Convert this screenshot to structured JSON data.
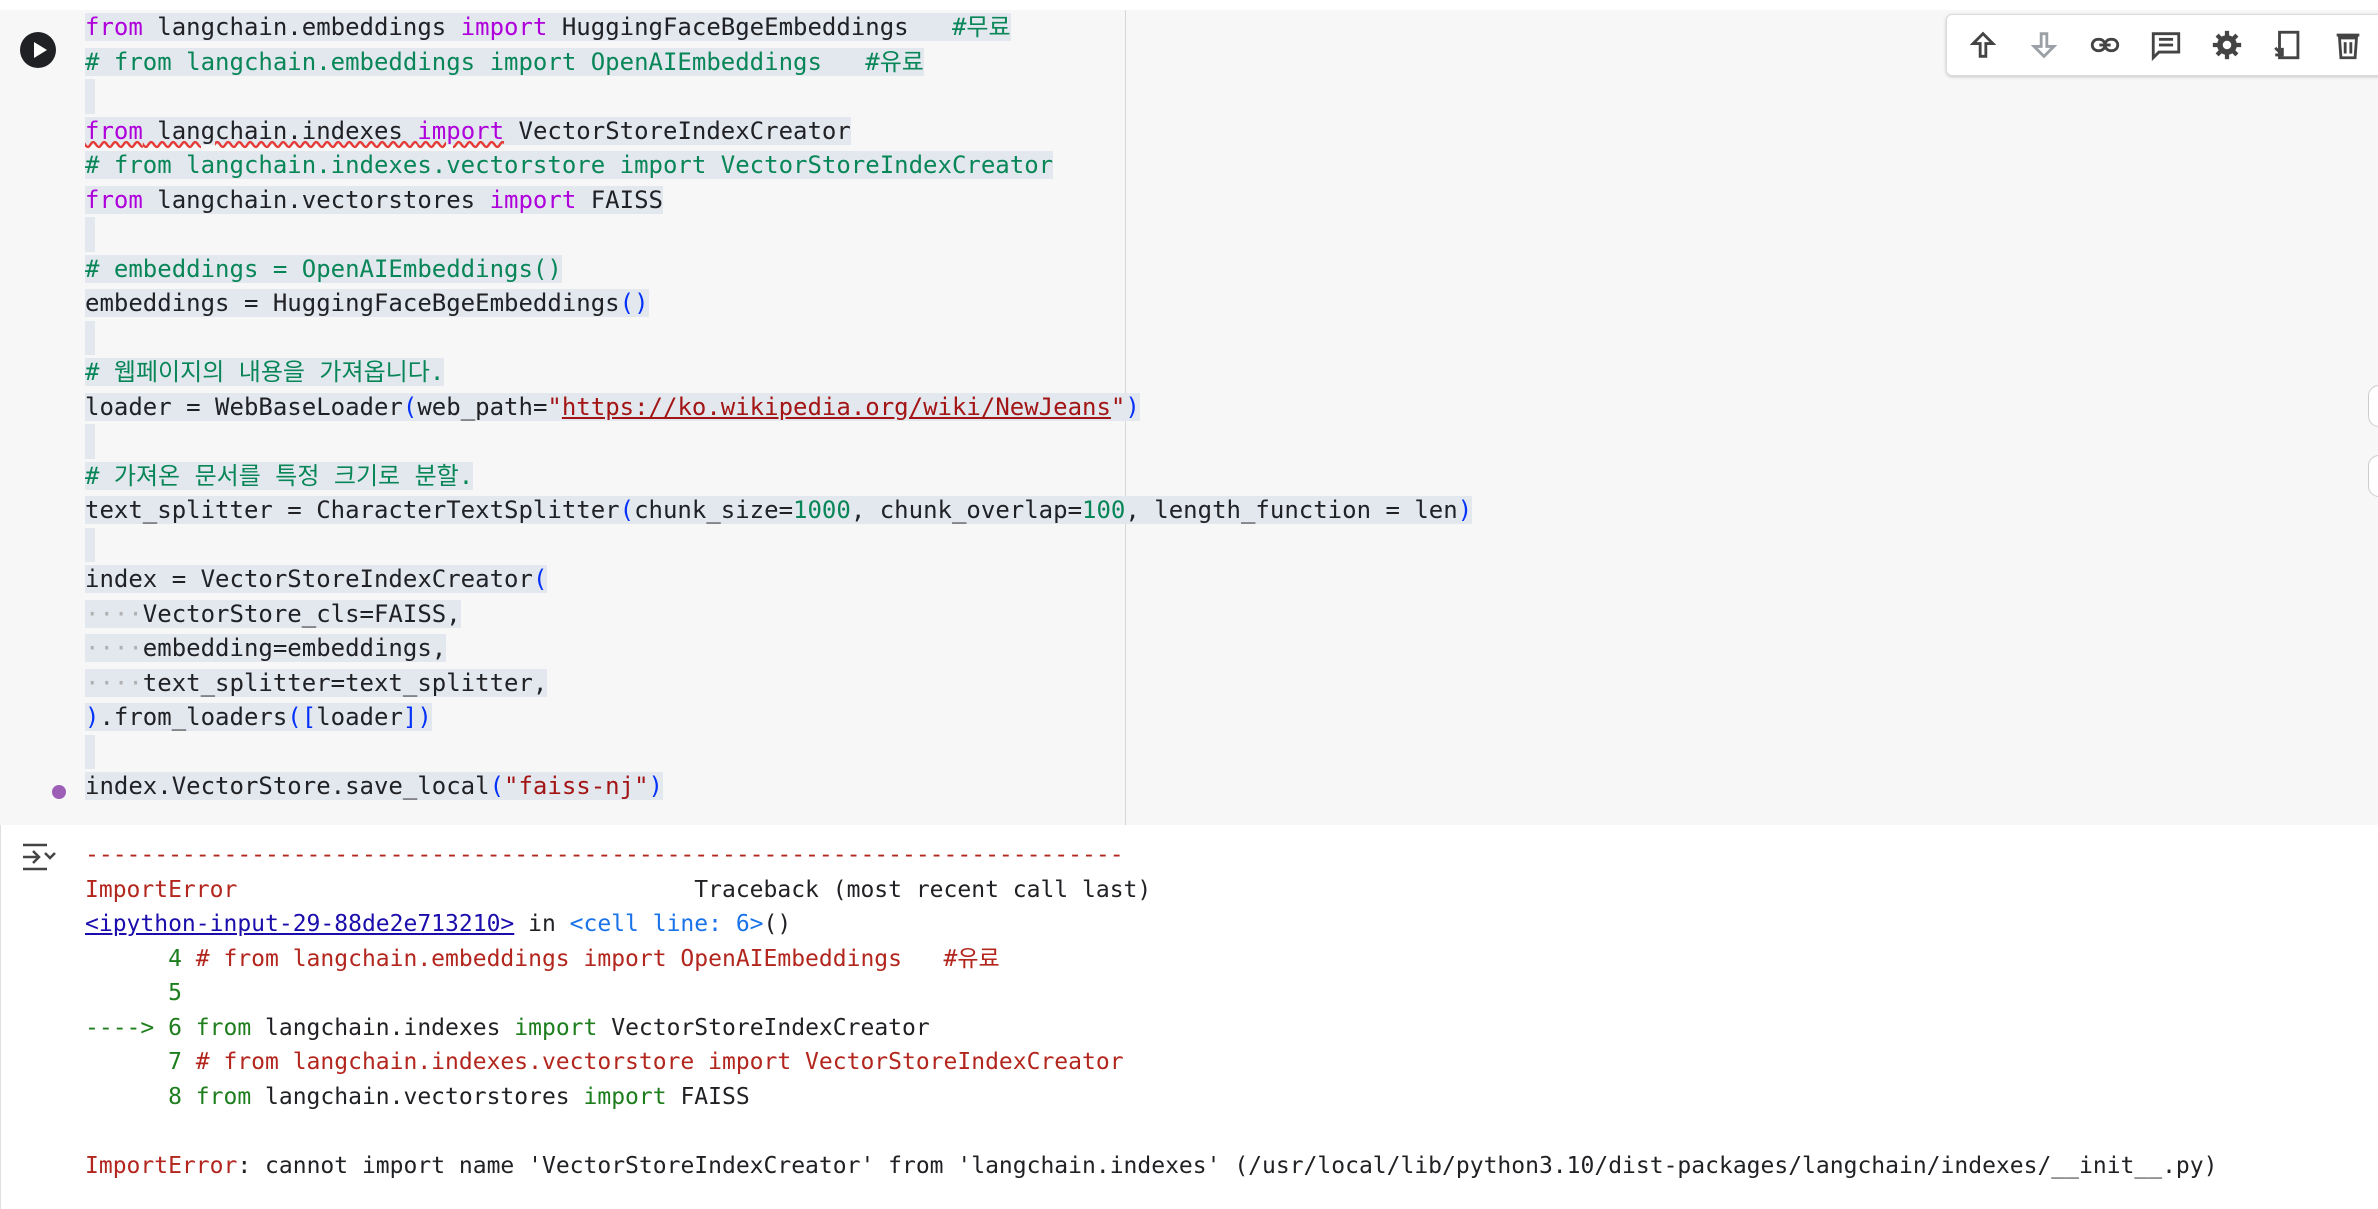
{
  "cell": {
    "lines": [
      [
        {
          "t": "from",
          "c": "kw"
        },
        {
          "t": " langchain.embeddings "
        },
        {
          "t": "import",
          "c": "kw"
        },
        {
          "t": " HuggingFaceBgeEmbeddings   "
        },
        {
          "t": "#무료",
          "c": "cm"
        }
      ],
      [
        {
          "t": "# from langchain.embeddings import OpenAIEmbeddings   #유료",
          "c": "cm"
        }
      ],
      [],
      [
        {
          "t": "from",
          "c": "kw sq"
        },
        {
          "t": " langchain.indexes ",
          "c": "sq"
        },
        {
          "t": "import",
          "c": "kw sq"
        },
        {
          "t": " VectorStoreIndexCreator"
        }
      ],
      [
        {
          "t": "# from langchain.indexes.vectorstore import VectorStoreIndexCreator",
          "c": "cm"
        }
      ],
      [
        {
          "t": "from",
          "c": "kw"
        },
        {
          "t": " langchain.vectorstores "
        },
        {
          "t": "import",
          "c": "kw"
        },
        {
          "t": " FAISS"
        }
      ],
      [],
      [
        {
          "t": "# embeddings = OpenAIEmbeddings()",
          "c": "cm"
        }
      ],
      [
        {
          "t": "embeddings = HuggingFaceBgeEmbeddings"
        },
        {
          "t": "()",
          "c": "br"
        }
      ],
      [],
      [
        {
          "t": "# 웹페이지의 내용을 가져옵니다.",
          "c": "cm"
        }
      ],
      [
        {
          "t": "loader = WebBaseLoader"
        },
        {
          "t": "(",
          "c": "br"
        },
        {
          "t": "web_path="
        },
        {
          "t": "\"",
          "c": "str"
        },
        {
          "t": "https://ko.wikipedia.org/wiki/NewJeans",
          "c": "url"
        },
        {
          "t": "\"",
          "c": "str"
        },
        {
          "t": ")",
          "c": "br"
        }
      ],
      [],
      [
        {
          "t": "# 가져온 문서를 특정 크기로 분할.",
          "c": "cm"
        }
      ],
      [
        {
          "t": "text_splitter = CharacterTextSplitter"
        },
        {
          "t": "(",
          "c": "br"
        },
        {
          "t": "chunk_size="
        },
        {
          "t": "1000",
          "c": "num"
        },
        {
          "t": ", chunk_overlap="
        },
        {
          "t": "100",
          "c": "num"
        },
        {
          "t": ", length_function = len"
        },
        {
          "t": ")",
          "c": "br"
        }
      ],
      [],
      [
        {
          "t": "index = VectorStoreIndexCreator"
        },
        {
          "t": "(",
          "c": "br"
        }
      ],
      [
        {
          "t": "····",
          "c": "dots"
        },
        {
          "t": "VectorStore_cls=FAISS,"
        }
      ],
      [
        {
          "t": "····",
          "c": "dots"
        },
        {
          "t": "embedding=embeddings,"
        }
      ],
      [
        {
          "t": "····",
          "c": "dots"
        },
        {
          "t": "text_splitter=text_splitter,"
        }
      ],
      [
        {
          "t": ")",
          "c": "br"
        },
        {
          "t": ".from_loaders"
        },
        {
          "t": "([",
          "c": "br"
        },
        {
          "t": "loader"
        },
        {
          "t": "])",
          "c": "br"
        }
      ],
      [],
      [
        {
          "t": "index.VectorStore.save_local"
        },
        {
          "t": "(",
          "c": "br"
        },
        {
          "t": "\"faiss-nj\"",
          "c": "str"
        },
        {
          "t": ")",
          "c": "br"
        }
      ]
    ]
  },
  "toolbar": {
    "buttons": [
      "move-up-icon",
      "move-down-icon",
      "link-icon",
      "comment-icon",
      "settings-icon",
      "mirror-cell-icon",
      "delete-icon"
    ]
  },
  "output": {
    "lines": [
      [
        {
          "t": "---------------------------------------------------------------------------",
          "c": "err"
        }
      ],
      [
        {
          "t": "ImportError",
          "c": "err"
        },
        {
          "t": "                                 Traceback (most recent call last)"
        }
      ],
      [
        {
          "t": "<ipython-input-29-88de2e713210>",
          "c": "link"
        },
        {
          "t": " in "
        },
        {
          "t": "<cell line: 6>",
          "c": "cellline"
        },
        {
          "t": "()"
        }
      ],
      [
        {
          "t": "      4 ",
          "c": "lnum"
        },
        {
          "t": "# from langchain.embeddings import OpenAIEmbeddings   #유료",
          "c": "err"
        }
      ],
      [
        {
          "t": "      5",
          "c": "lnum"
        }
      ],
      [
        {
          "t": "----> 6 ",
          "c": "lnum"
        },
        {
          "t": "from",
          "c": "okw"
        },
        {
          "t": " langchain.indexes "
        },
        {
          "t": "import",
          "c": "okw"
        },
        {
          "t": " VectorStoreIndexCreator"
        }
      ],
      [
        {
          "t": "      7 ",
          "c": "lnum"
        },
        {
          "t": "# from langchain.indexes.vectorstore import VectorStoreIndexCreator",
          "c": "err"
        }
      ],
      [
        {
          "t": "      8 ",
          "c": "lnum"
        },
        {
          "t": "from",
          "c": "okw"
        },
        {
          "t": " langchain.vectorstores "
        },
        {
          "t": "import",
          "c": "okw"
        },
        {
          "t": " FAISS"
        }
      ],
      [],
      [
        {
          "t": "ImportError",
          "c": "err"
        },
        {
          "t": ": cannot import name 'VectorStoreIndexCreator' from 'langchain.indexes' (/usr/local/lib/python3.10/dist-packages/langchain/indexes/__init__.py)"
        }
      ]
    ]
  }
}
